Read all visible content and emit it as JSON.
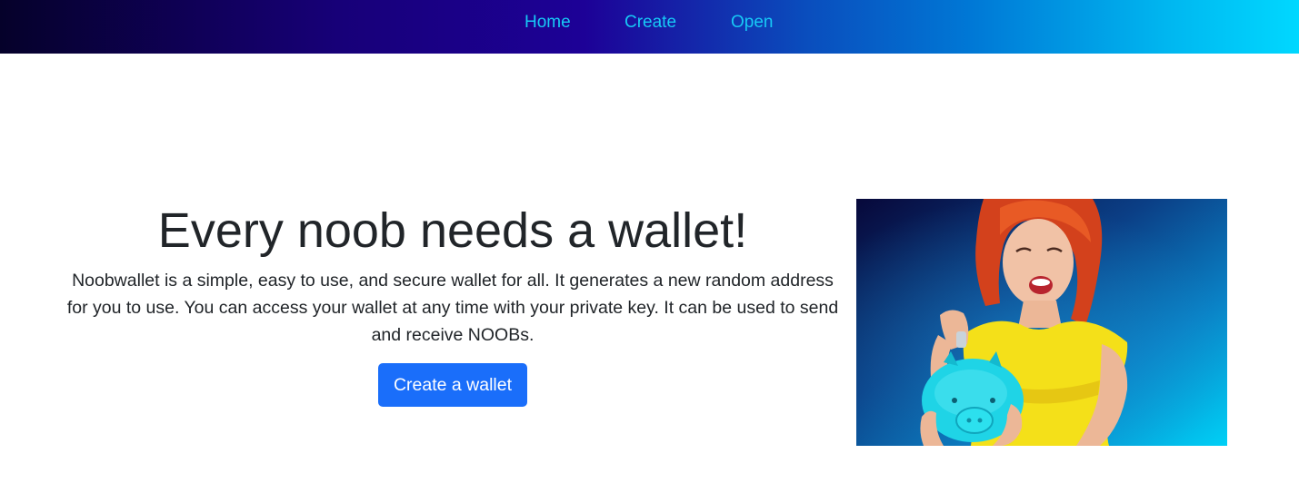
{
  "nav": {
    "items": [
      {
        "label": "Home"
      },
      {
        "label": "Create"
      },
      {
        "label": "Open"
      }
    ]
  },
  "hero": {
    "title": "Every noob needs a wallet!",
    "description": "Noobwallet is a simple, easy to use, and secure wallet for all. It generates a new random address for you to use. You can access your wallet at any time with your private key. It can be used to send and receive NOOBs.",
    "cta_label": "Create a wallet",
    "image_icon": "woman-with-piggy-bank-photo"
  },
  "colors": {
    "nav_link": "#17c9f6",
    "cta_background": "#1a6efa",
    "text": "#212529"
  }
}
